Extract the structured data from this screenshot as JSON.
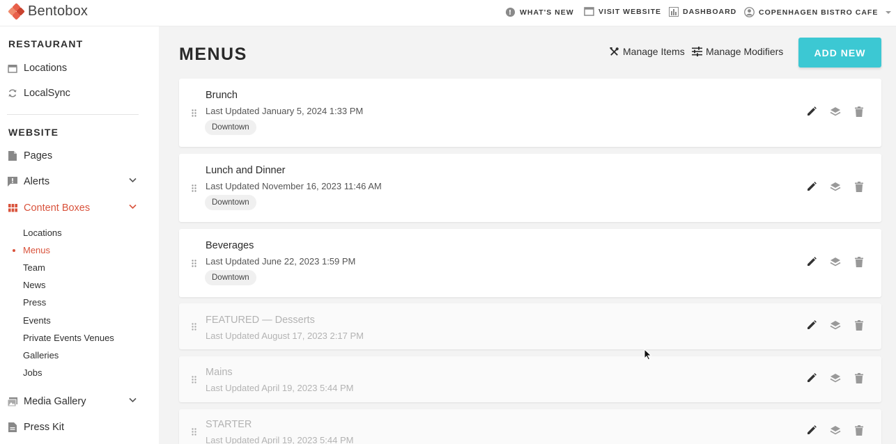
{
  "app": {
    "name": "Bentobox"
  },
  "topnav": {
    "whats_new": "WHAT'S NEW",
    "visit_website": "VISIT WEBSITE",
    "dashboard": "DASHBOARD",
    "account": "COPENHAGEN BISTRO CAFE"
  },
  "sidebar": {
    "restaurant_title": "RESTAURANT",
    "restaurant_items": [
      {
        "label": "Locations",
        "icon": "storefront-icon"
      },
      {
        "label": "LocalSync",
        "icon": "sync-icon"
      }
    ],
    "website_title": "WEBSITE",
    "website_items": [
      {
        "label": "Pages",
        "icon": "page-icon"
      },
      {
        "label": "Alerts",
        "icon": "alert-icon"
      },
      {
        "label": "Content Boxes",
        "icon": "grid-icon",
        "active": true
      }
    ],
    "content_box_items": [
      {
        "label": "Locations"
      },
      {
        "label": "Menus",
        "active": true
      },
      {
        "label": "Team"
      },
      {
        "label": "News"
      },
      {
        "label": "Press"
      },
      {
        "label": "Events"
      },
      {
        "label": "Private Events Venues"
      },
      {
        "label": "Galleries"
      },
      {
        "label": "Jobs"
      }
    ],
    "bottom_items": [
      {
        "label": "Media Gallery",
        "icon": "image-icon"
      },
      {
        "label": "Press Kit",
        "icon": "document-icon"
      }
    ]
  },
  "main": {
    "title": "MENUS",
    "manage_items": "Manage Items",
    "manage_modifiers": "Manage Modifiers",
    "add_new": "ADD NEW",
    "menus": [
      {
        "title": "Brunch",
        "updated": "Last Updated January 5, 2024 1:33 PM",
        "tag": "Downtown",
        "dim": false
      },
      {
        "title": "Lunch and Dinner",
        "updated": "Last Updated November 16, 2023 11:46 AM",
        "tag": "Downtown",
        "dim": false
      },
      {
        "title": "Beverages",
        "updated": "Last Updated June 22, 2023 1:59 PM",
        "tag": "Downtown",
        "dim": false
      },
      {
        "title": "FEATURED — Desserts",
        "updated": "Last Updated August 17, 2023 2:17 PM",
        "tag": "",
        "dim": true
      },
      {
        "title": "Mains",
        "updated": "Last Updated April 19, 2023 5:44 PM",
        "tag": "",
        "dim": true
      },
      {
        "title": "STARTER",
        "updated": "Last Updated April 19, 2023 5:44 PM",
        "tag": "",
        "dim": true
      }
    ]
  },
  "colors": {
    "accent": "#d9533c",
    "button": "#3cc8d3"
  }
}
